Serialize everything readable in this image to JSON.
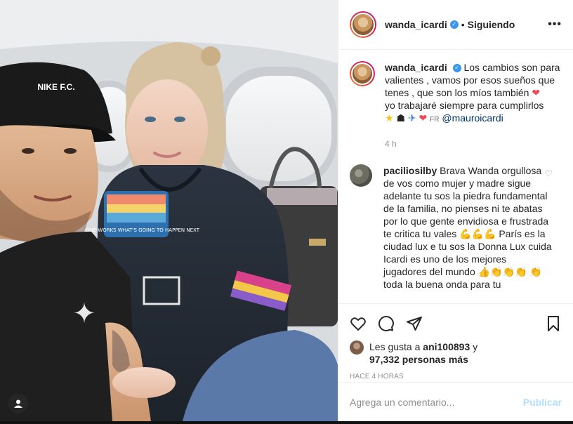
{
  "post": {
    "username": "wanda_icardi",
    "follow_separator": "•",
    "follow_label": "Siguiendo",
    "more_label": "•••",
    "caption": {
      "username": "wanda_icardi",
      "line1": "Los cambios son para valientes , vamos por esos sueños que tenes , que son los míos también",
      "line2": "yo trabajaré siempre para cumplirlos",
      "fr": "FR",
      "mention": "@mauroicardi",
      "time": "4 h"
    },
    "comment": {
      "username": "paciliosilby",
      "text1": "Brava Wanda orgullosa de vos como mujer y madre sigue adelante tu sos la piedra fundamental de la familia, no pienses ni te abatas por lo que gente envidiosa e frustrada te critica tu vales",
      "text2": "París es la ciudad lux e tu sos la Donna Lux cuida Icardi es uno de los mejores jugadores del mundo",
      "text3": "toda la buena onda para tu"
    },
    "likes": {
      "prefix": "Les gusta a",
      "user": "ani100893",
      "conj": "y",
      "count": "97,332 personas más"
    },
    "posted_ago": "HACE 4 HORAS",
    "add_comment_placeholder": "Agrega un comentario...",
    "publish_label": "Publicar"
  },
  "photo": {
    "cap_text": "NIKE F.C.",
    "patch_text": "ONE-ONE-WORKS WHAT'S GOING TO HAPPEN NEXT"
  },
  "colors": {
    "accent": "#3897f0",
    "publish_disabled": "#b2dffc",
    "border": "#efefef",
    "muted": "#8e8e8e"
  }
}
